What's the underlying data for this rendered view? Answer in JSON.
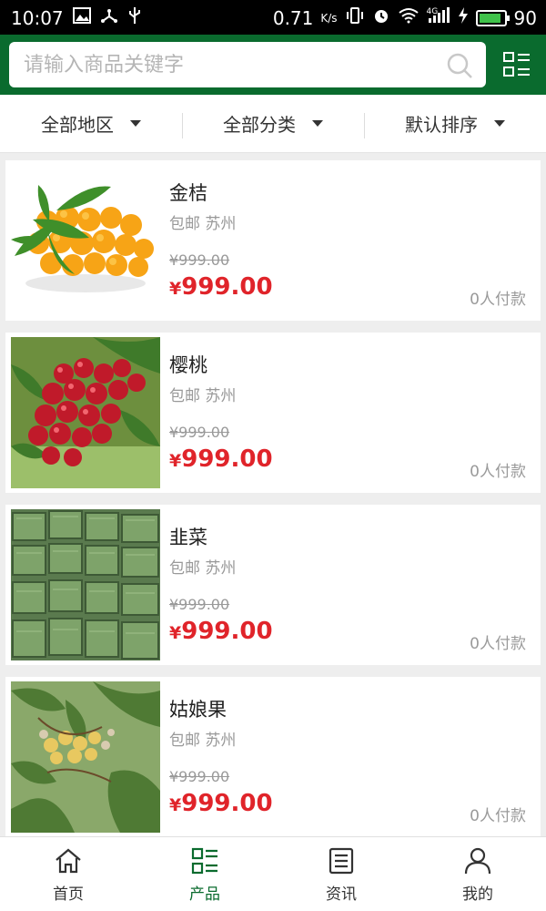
{
  "statusbar": {
    "time": "10:07",
    "speed": "0.71",
    "speed_unit": "K/s",
    "signal": "4G",
    "battery": "90",
    "battery_level": 0.9
  },
  "search": {
    "placeholder": "请输入商品关键字"
  },
  "filters": [
    {
      "label": "全部地区"
    },
    {
      "label": "全部分类"
    },
    {
      "label": "默认排序"
    }
  ],
  "products": [
    {
      "name": "金桔",
      "shipping": "包邮 苏州",
      "old_price": "¥999.00",
      "currency": "¥",
      "price": "999.00",
      "paid": "0人付款",
      "image": "kumquat"
    },
    {
      "name": "樱桃",
      "shipping": "包邮 苏州",
      "old_price": "¥999.00",
      "currency": "¥",
      "price": "999.00",
      "paid": "0人付款",
      "image": "cherry"
    },
    {
      "name": "韭菜",
      "shipping": "包邮 苏州",
      "old_price": "¥999.00",
      "currency": "¥",
      "price": "999.00",
      "paid": "0人付款",
      "image": "chives"
    },
    {
      "name": "姑娘果",
      "shipping": "包邮 苏州",
      "old_price": "¥999.00",
      "currency": "¥",
      "price": "999.00",
      "paid": "0人付款",
      "image": "groundcherry"
    }
  ],
  "nav": [
    {
      "label": "首页",
      "icon": "home-icon"
    },
    {
      "label": "产品",
      "icon": "grid-list-icon",
      "active": true
    },
    {
      "label": "资讯",
      "icon": "news-icon"
    },
    {
      "label": "我的",
      "icon": "user-icon"
    }
  ],
  "colors": {
    "brand": "#0a6b2e",
    "price": "#e0242a"
  }
}
